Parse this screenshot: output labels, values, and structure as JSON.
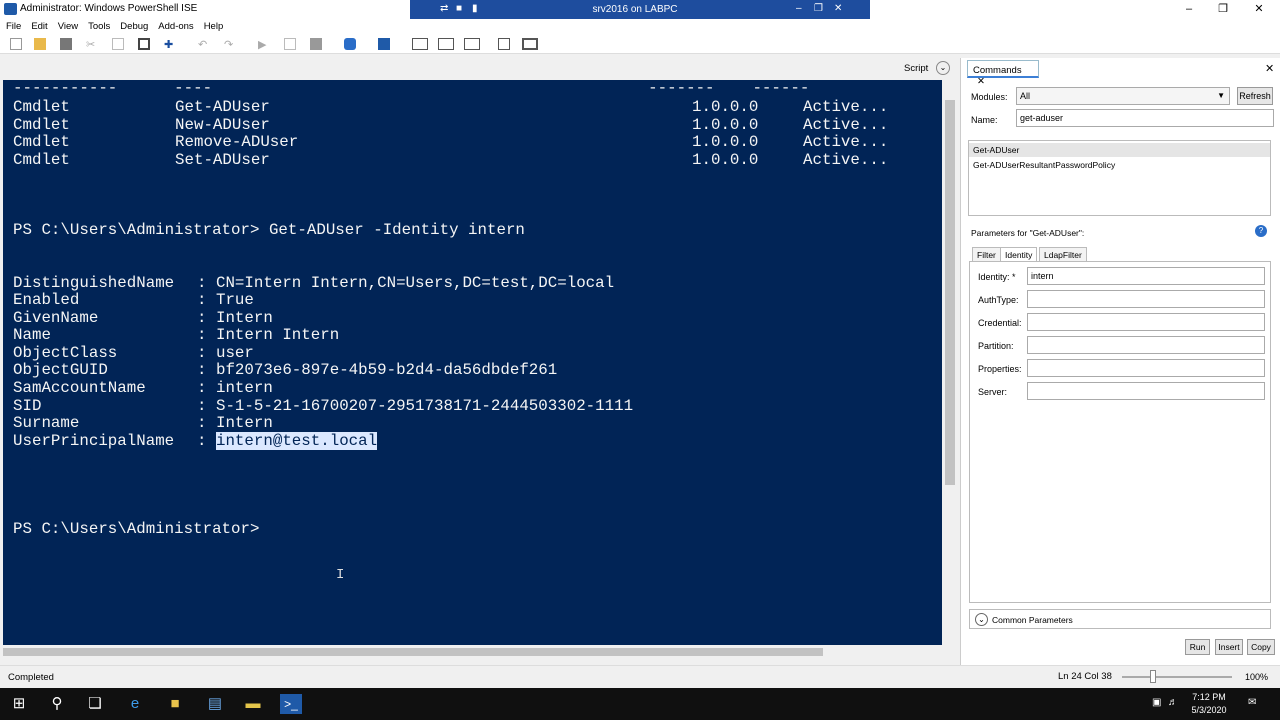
{
  "window": {
    "title": "Administrator: Windows PowerShell ISE",
    "rdp_title": "srv2016 on LABPC"
  },
  "menu": [
    "File",
    "Edit",
    "View",
    "Tools",
    "Debug",
    "Add-ons",
    "Help"
  ],
  "scriptbar": {
    "label": "Script"
  },
  "console": {
    "module_rows": [
      {
        "type": "Cmdlet",
        "name": "Get-ADUser",
        "version": "1.0.0.0",
        "module": "Active..."
      },
      {
        "type": "Cmdlet",
        "name": "New-ADUser",
        "version": "1.0.0.0",
        "module": "Active..."
      },
      {
        "type": "Cmdlet",
        "name": "Remove-ADUser",
        "version": "1.0.0.0",
        "module": "Active..."
      },
      {
        "type": "Cmdlet",
        "name": "Set-ADUser",
        "version": "1.0.0.0",
        "module": "Active..."
      }
    ],
    "header_dashes": [
      "-----------",
      "----",
      "-------",
      "------"
    ],
    "command": "PS C:\\Users\\Administrator> Get-ADUser -Identity intern",
    "properties": [
      {
        "key": "DistinguishedName",
        "value": "CN=Intern Intern,CN=Users,DC=test,DC=local"
      },
      {
        "key": "Enabled",
        "value": "True"
      },
      {
        "key": "GivenName",
        "value": "Intern"
      },
      {
        "key": "Name",
        "value": "Intern Intern"
      },
      {
        "key": "ObjectClass",
        "value": "user"
      },
      {
        "key": "ObjectGUID",
        "value": "bf2073e6-897e-4b59-b2d4-da56dbdef261"
      },
      {
        "key": "SamAccountName",
        "value": "intern"
      },
      {
        "key": "SID",
        "value": "S-1-5-21-16700207-2951738171-2444503302-1111"
      },
      {
        "key": "Surname",
        "value": "Intern"
      },
      {
        "key": "UserPrincipalName",
        "value": "intern@test.local"
      }
    ],
    "prompt": "PS C:\\Users\\Administrator>"
  },
  "status": {
    "text": "Completed",
    "line_col": "Ln 24  Col 38",
    "zoom": "100%"
  },
  "commands_panel": {
    "tab": "Commands",
    "modules_label": "Modules:",
    "modules_value": "All",
    "refresh": "Refresh",
    "name_label": "Name:",
    "name_value": "get-aduser",
    "results": [
      "Get-ADUser",
      "Get-ADUserResultantPasswordPolicy"
    ],
    "params_for": "Parameters for \"Get-ADUser\":",
    "param_tabs": [
      "Filter",
      "Identity",
      "LdapFilter"
    ],
    "params": [
      {
        "label": "Identity: *",
        "value": "intern"
      },
      {
        "label": "AuthType:",
        "value": ""
      },
      {
        "label": "Credential:",
        "value": ""
      },
      {
        "label": "Partition:",
        "value": ""
      },
      {
        "label": "Properties:",
        "value": ""
      },
      {
        "label": "Server:",
        "value": ""
      }
    ],
    "common": "Common Parameters",
    "buttons": [
      "Run",
      "Insert",
      "Copy"
    ]
  },
  "taskbar": {
    "time": "7:12 PM",
    "date": "5/3/2020"
  },
  "colors": {
    "console_bg": "#012456",
    "console_fg": "#f5f5f5",
    "rdp_bar": "#1e4d9e"
  }
}
